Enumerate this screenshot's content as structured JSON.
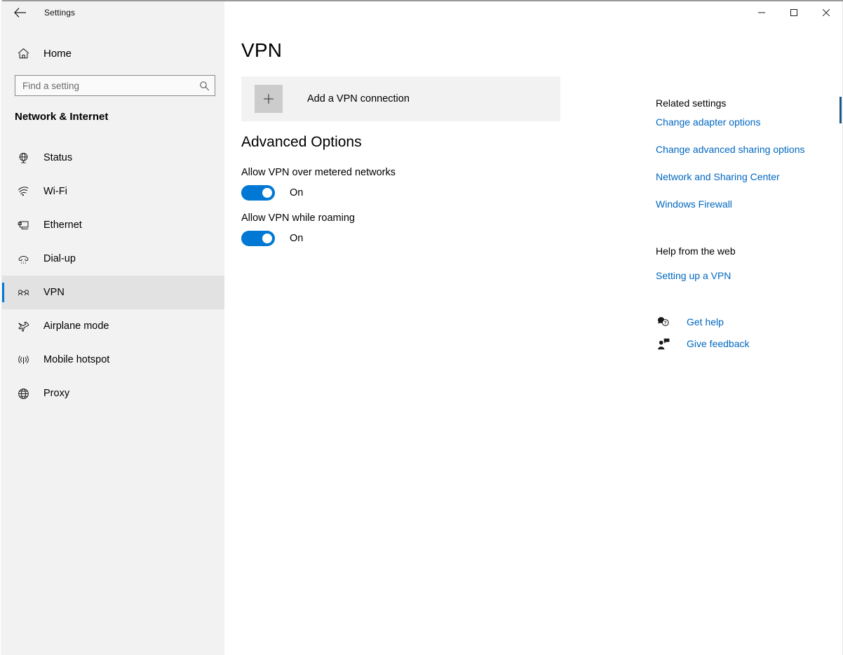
{
  "window": {
    "title": "Settings",
    "back_icon": "back-arrow-icon",
    "minimize_label": "Minimize",
    "maximize_label": "Maximize",
    "close_label": "Close"
  },
  "sidebar": {
    "home": {
      "label": "Home",
      "icon": "home-icon"
    },
    "search": {
      "placeholder": "Find a setting",
      "value": "",
      "icon": "search-icon"
    },
    "category": "Network & Internet",
    "items": [
      {
        "label": "Status",
        "icon": "status-globe-icon",
        "selected": false
      },
      {
        "label": "Wi-Fi",
        "icon": "wifi-icon",
        "selected": false
      },
      {
        "label": "Ethernet",
        "icon": "ethernet-icon",
        "selected": false
      },
      {
        "label": "Dial-up",
        "icon": "dialup-phone-icon",
        "selected": false
      },
      {
        "label": "VPN",
        "icon": "vpn-key-icon",
        "selected": true
      },
      {
        "label": "Airplane mode",
        "icon": "airplane-icon",
        "selected": false
      },
      {
        "label": "Mobile hotspot",
        "icon": "hotspot-icon",
        "selected": false
      },
      {
        "label": "Proxy",
        "icon": "proxy-globe-icon",
        "selected": false
      }
    ]
  },
  "main": {
    "page_title": "VPN",
    "add_connection": {
      "label": "Add a VPN connection",
      "icon": "plus-icon"
    },
    "advanced_heading": "Advanced Options",
    "options": [
      {
        "label": "Allow VPN over metered networks",
        "state": "On",
        "checked": true
      },
      {
        "label": "Allow VPN while roaming",
        "state": "On",
        "checked": true
      }
    ]
  },
  "rail": {
    "related_heading": "Related settings",
    "related_links": [
      "Change adapter options",
      "Change advanced sharing options",
      "Network and Sharing Center",
      "Windows Firewall"
    ],
    "help_heading": "Help from the web",
    "help_links": [
      "Setting up a VPN"
    ],
    "support": [
      {
        "label": "Get help",
        "icon": "question-bubble-icon"
      },
      {
        "label": "Give feedback",
        "icon": "feedback-person-icon"
      }
    ]
  },
  "colors": {
    "accent": "#0078d4",
    "link": "#0067c0",
    "sidebar_bg": "#f2f2f2",
    "selected_row_bg": "#e2e2e2",
    "band_bg": "#f2f2f2",
    "tile_bg": "#cccccc"
  }
}
